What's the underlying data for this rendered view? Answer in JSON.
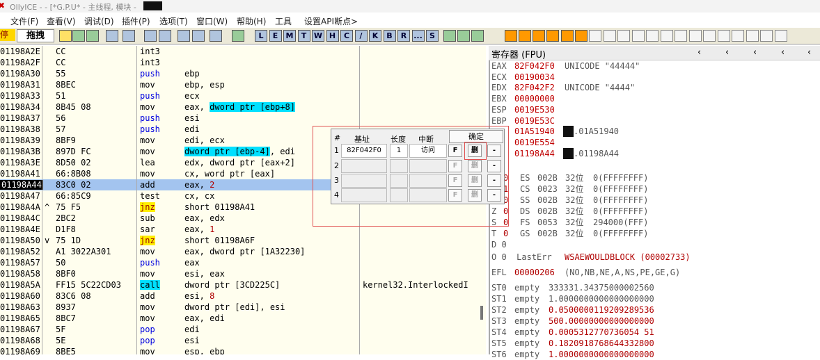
{
  "title_bar": {
    "text": "OllyICE - - [*G.P.U* - 主线程, 模块 - ",
    "icon": "olly-icon"
  },
  "menu": [
    "文件(F)",
    "查看(V)",
    "调试(D)",
    "插件(P)",
    "选项(T)",
    "窗口(W)",
    "帮助(H)",
    "工具",
    "设置API断点>"
  ],
  "toolbar": {
    "mode_label": "停",
    "drag_label": "拖拽",
    "letter_buttons": [
      "L",
      "E",
      "M",
      "T",
      "W",
      "H",
      "C",
      "/",
      "K",
      "B",
      "R",
      "...",
      "S"
    ]
  },
  "disasm": {
    "rows": [
      {
        "addr": "01198A2E",
        "mark": "",
        "hex": "CC",
        "mn": "int3",
        "op": "",
        "comment": ""
      },
      {
        "addr": "01198A2F",
        "mark": "",
        "hex": "CC",
        "mn": "int3",
        "op": "",
        "comment": ""
      },
      {
        "addr": "01198A30",
        "mark": "",
        "hex": "55",
        "mn": "push",
        "op": "ebp",
        "comment": ""
      },
      {
        "addr": "01198A31",
        "mark": "",
        "hex": "8BEC",
        "mn": "mov",
        "op": "ebp, esp",
        "comment": ""
      },
      {
        "addr": "01198A33",
        "mark": "",
        "hex": "51",
        "mn": "push",
        "op": "ecx",
        "comment": ""
      },
      {
        "addr": "01198A34",
        "mark": "",
        "hex": "8B45 08",
        "mn": "mov",
        "op_pre": "eax, ",
        "op_hl": "dword ptr [ebp+8]",
        "op_post": "",
        "comment": ""
      },
      {
        "addr": "01198A37",
        "mark": "",
        "hex": "56",
        "mn": "push",
        "op": "esi",
        "comment": ""
      },
      {
        "addr": "01198A38",
        "mark": "",
        "hex": "57",
        "mn": "push",
        "op": "edi",
        "comment": ""
      },
      {
        "addr": "01198A39",
        "mark": "",
        "hex": "8BF9",
        "mn": "mov",
        "op": "edi, ecx",
        "comment": ""
      },
      {
        "addr": "01198A3B",
        "mark": "",
        "hex": "897D FC",
        "mn": "mov",
        "op_pre": "",
        "op_hl": "dword ptr [ebp-4]",
        "op_post": ", edi",
        "comment": ""
      },
      {
        "addr": "01198A3E",
        "mark": "",
        "hex": "8D50 02",
        "mn": "lea",
        "op": "edx, dword ptr [eax+2]",
        "comment": ""
      },
      {
        "addr": "01198A41",
        "mark": "",
        "hex": "66:8B08",
        "mn": "mov",
        "op": "cx, word ptr [eax]",
        "comment": ""
      },
      {
        "addr": "01198A44",
        "mark": "",
        "hex": "83C0 02",
        "mn": "add",
        "op_pre": "eax, ",
        "op_red": "2",
        "comment": "",
        "selected": true
      },
      {
        "addr": "01198A47",
        "mark": "",
        "hex": "66:85C9",
        "mn": "test",
        "op": "cx, cx",
        "comment": ""
      },
      {
        "addr": "01198A4A",
        "mark": "^",
        "hex": "75 F5",
        "mn": "jnz",
        "op": "short 01198A41",
        "comment": ""
      },
      {
        "addr": "01198A4C",
        "mark": "",
        "hex": "2BC2",
        "mn": "sub",
        "op": "eax, edx",
        "comment": ""
      },
      {
        "addr": "01198A4E",
        "mark": "",
        "hex": "D1F8",
        "mn": "sar",
        "op_pre": "eax, ",
        "op_red": "1",
        "comment": ""
      },
      {
        "addr": "01198A50",
        "mark": "v",
        "hex": "75 1D",
        "mn": "jnz",
        "op": "short 01198A6F",
        "comment": ""
      },
      {
        "addr": "01198A52",
        "mark": "",
        "hex": "A1 3022A301",
        "mn": "mov",
        "op": "eax, dword ptr [1A32230]",
        "comment": ""
      },
      {
        "addr": "01198A57",
        "mark": "",
        "hex": "50",
        "mn": "push",
        "op": "eax",
        "comment": ""
      },
      {
        "addr": "01198A58",
        "mark": "",
        "hex": "8BF0",
        "mn": "mov",
        "op": "esi, eax",
        "comment": ""
      },
      {
        "addr": "01198A5A",
        "mark": "",
        "hex": "FF15 5C22CD03",
        "mn": "call",
        "op": "dword ptr [3CD225C]",
        "comment": "kernel32.InterlockedI"
      },
      {
        "addr": "01198A60",
        "mark": "",
        "hex": "83C6 08",
        "mn": "add",
        "op_pre": "esi, ",
        "op_red": "8",
        "comment": ""
      },
      {
        "addr": "01198A63",
        "mark": "",
        "hex": "8937",
        "mn": "mov",
        "op": "dword ptr [edi], esi",
        "comment": ""
      },
      {
        "addr": "01198A65",
        "mark": "",
        "hex": "8BC7",
        "mn": "mov",
        "op": "eax, edi",
        "comment": ""
      },
      {
        "addr": "01198A67",
        "mark": "",
        "hex": "5F",
        "mn": "pop",
        "op": "edi",
        "comment": ""
      },
      {
        "addr": "01198A68",
        "mark": "",
        "hex": "5E",
        "mn": "pop",
        "op": "esi",
        "comment": ""
      },
      {
        "addr": "01198A69",
        "mark": "",
        "hex": "8BE5",
        "mn": "mov",
        "op": "esp, ebp",
        "comment": ""
      }
    ]
  },
  "registers": {
    "header": "寄存器 (FPU)",
    "gp": [
      {
        "name": "EAX",
        "val": "82F042F0",
        "desc": "UNICODE \"44444\""
      },
      {
        "name": "ECX",
        "val": "00190034",
        "desc": ""
      },
      {
        "name": "EDX",
        "val": "82F042F2",
        "desc": "UNICODE \"4444\""
      },
      {
        "name": "EBX",
        "val": "00000000",
        "desc": ""
      },
      {
        "name": "ESP",
        "val": "0019E530",
        "desc": ""
      },
      {
        "name": "EBP",
        "val": "0019E53C",
        "desc": ""
      },
      {
        "name": "",
        "val": "01A51940",
        "desc": ".01A51940"
      },
      {
        "name": "",
        "val": "0019E554",
        "desc": ""
      },
      {
        "name": "",
        "val": "01198A44",
        "desc": ".01198A44"
      }
    ],
    "segs": [
      {
        "flag": "",
        "bit": "0",
        "seg": "ES",
        "sel": "002B",
        "bits": "32位",
        "base": "0(FFFFFFFF)"
      },
      {
        "flag": "",
        "bit": "1",
        "seg": "CS",
        "sel": "0023",
        "bits": "32位",
        "base": "0(FFFFFFFF)"
      },
      {
        "flag": "",
        "bit": "0",
        "seg": "SS",
        "sel": "002B",
        "bits": "32位",
        "base": "0(FFFFFFFF)"
      },
      {
        "flag": "Z",
        "bit": "0",
        "seg": "DS",
        "sel": "002B",
        "bits": "32位",
        "base": "0(FFFFFFFF)"
      },
      {
        "flag": "S",
        "bit": "0",
        "seg": "FS",
        "sel": "0053",
        "bits": "32位",
        "base": "294000(FFF)"
      },
      {
        "flag": "T",
        "bit": "0",
        "seg": "GS",
        "sel": "002B",
        "bits": "32位",
        "base": "0(FFFFFFFF)"
      }
    ],
    "d_flag": "D 0",
    "lasterr": {
      "label": "O 0  LastErr",
      "val": "WSAEWOULDBLOCK (00002733)"
    },
    "efl": {
      "label": "EFL",
      "val": "00000206",
      "desc": "(NO,NB,NE,A,NS,PE,GE,G)"
    },
    "fpu": [
      {
        "name": "ST0",
        "state": "empty",
        "val": "333331.34375000002560"
      },
      {
        "name": "ST1",
        "state": "empty",
        "val": "1.0000000000000000000"
      },
      {
        "name": "ST2",
        "state": "empty",
        "val": "0.0500000119209289536"
      },
      {
        "name": "ST3",
        "state": "empty",
        "val": "500.00000000000000000"
      },
      {
        "name": "ST4",
        "state": "empty",
        "val": "0.0005312770736054 51"
      },
      {
        "name": "ST5",
        "state": "empty",
        "val": "0.1820918768644332800"
      },
      {
        "name": "ST6",
        "state": "empty",
        "val": "1.0000000000000000000"
      }
    ]
  },
  "bp_dialog": {
    "headers": {
      "num": "#",
      "base": "基址",
      "len": "长度",
      "brk": "中断"
    },
    "ok_label": "确定",
    "row1": {
      "num": "1",
      "base": "82F042F0",
      "len": "1",
      "access": "访问",
      "f": "F",
      "del": "删",
      "minus": "-"
    },
    "empty_rows": [
      {
        "num": "2"
      },
      {
        "num": "3"
      },
      {
        "num": "4"
      }
    ],
    "f_label": "F",
    "del_label": "删",
    "minus_label": "-"
  }
}
